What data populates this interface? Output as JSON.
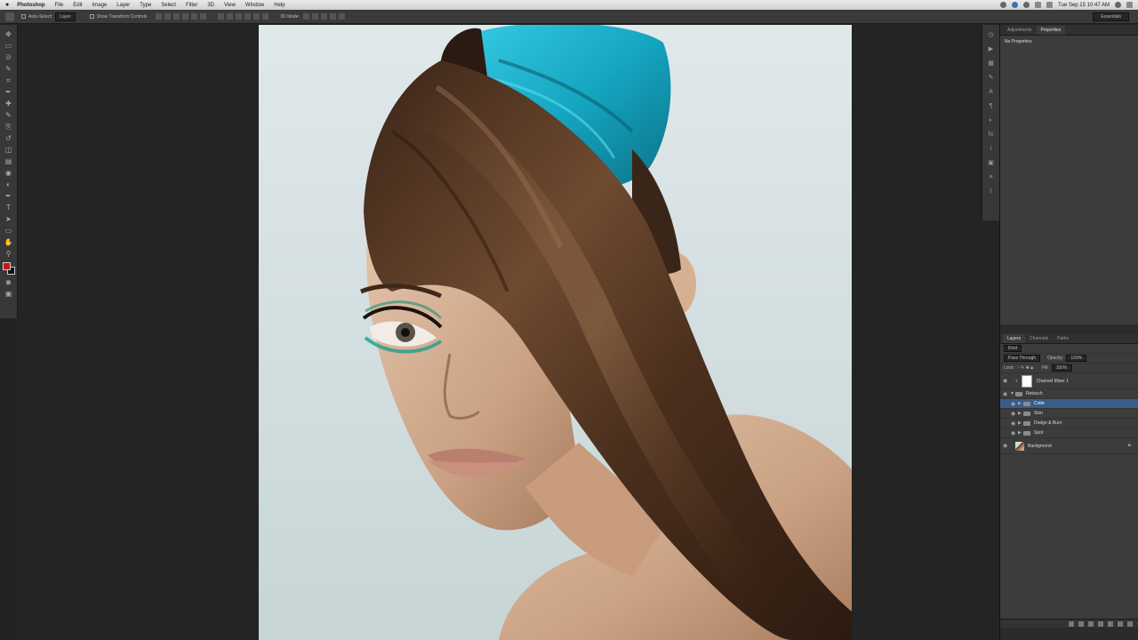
{
  "menubar": {
    "apple": "",
    "app_name": "Photoshop",
    "items": [
      "File",
      "Edit",
      "Image",
      "Layer",
      "Type",
      "Select",
      "Filter",
      "3D",
      "View",
      "Window",
      "Help"
    ],
    "clock": "Tue Sep 15  10:47 AM"
  },
  "options_bar": {
    "auto_select_label": "Auto-Select:",
    "auto_select_value": "Layer",
    "transform_label": "Show Transform Controls",
    "mode_label": "3D Mode:",
    "workspace": "Essentials"
  },
  "toolbar": {
    "tools": [
      "move-tool",
      "marquee-tool",
      "lasso-tool",
      "quick-select-tool",
      "crop-tool",
      "eyedropper-tool",
      "healing-tool",
      "brush-tool",
      "clone-stamp-tool",
      "history-brush-tool",
      "eraser-tool",
      "gradient-tool",
      "blur-tool",
      "dodge-tool",
      "pen-tool",
      "type-tool",
      "path-select-tool",
      "shape-tool",
      "hand-tool",
      "zoom-tool"
    ],
    "tool_glyphs": [
      "✥",
      "▭",
      "ᘐ",
      "✎",
      "⌗",
      "✒",
      "✚",
      "✎",
      "⎘",
      "↺",
      "◫",
      "▤",
      "◉",
      "◐",
      "✒",
      "T",
      "➤",
      "▭",
      "✋",
      "⚲"
    ],
    "foreground_color": "#d01010",
    "background_color": "#111111"
  },
  "right_iconstrip": {
    "icons": [
      "history-icon",
      "actions-icon",
      "swatches-icon",
      "brush-preset-icon",
      "character-icon",
      "paragraph-icon",
      "adjustments-icon",
      "styles-icon",
      "info-icon",
      "navigator-icon",
      "channels-icon",
      "paths-icon"
    ]
  },
  "properties_panel": {
    "tabs": [
      "Adjustments",
      "Properties"
    ],
    "active_tab": 1,
    "body_text": "No Properties"
  },
  "layers_panel": {
    "tabs": [
      "Layers",
      "Channels",
      "Paths"
    ],
    "active_tab": 0,
    "kind_label": "Kind",
    "blend_mode": "Pass Through",
    "opacity_label": "Opacity:",
    "opacity_value": "100%",
    "lock_label": "Lock:",
    "fill_label": "Fill:",
    "fill_value": "100%",
    "layers": [
      {
        "name": "Channel Mixer 1",
        "kind": "adjustment",
        "selected": false
      },
      {
        "name": "Retouch",
        "kind": "group-open",
        "selected": false
      },
      {
        "name": "Color",
        "kind": "group",
        "selected": true
      },
      {
        "name": "Skin",
        "kind": "group",
        "selected": false
      },
      {
        "name": "Dodge & Burn",
        "kind": "group",
        "selected": false
      },
      {
        "name": "Spot",
        "kind": "group",
        "selected": false
      },
      {
        "name": "Background",
        "kind": "pixel",
        "selected": false
      }
    ]
  },
  "colors": {
    "panel_bg": "#3c3c3c",
    "selected_layer": "#3a5d88",
    "hair_accent": "#19b4cf"
  }
}
